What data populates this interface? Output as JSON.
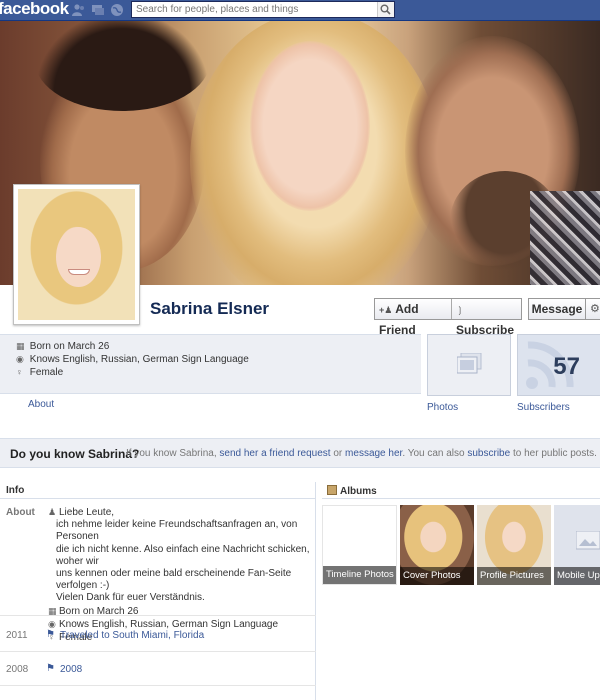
{
  "topbar": {
    "logo": "facebook",
    "search_placeholder": "Search for people, places and things"
  },
  "profile": {
    "name": "Sabrina Elsner"
  },
  "actions": {
    "add_friend": "Add Friend",
    "subscribe": "Subscribe",
    "message": "Message"
  },
  "info_strip": {
    "born": "Born on March 26",
    "languages": "Knows English, Russian, German Sign Language",
    "gender": "Female",
    "about_link": "About"
  },
  "tiles": {
    "photos_label": "Photos",
    "subscribers_label": "Subscribers",
    "subscribers_count": "57"
  },
  "know_bar": {
    "title": "Do you know Sabrina?",
    "t1": "If you know Sabrina,",
    "link1": "send her a friend request",
    "t2": "or",
    "link2": "message her",
    "t3": ". You can also",
    "link3": "subscribe",
    "t4": "to her public posts."
  },
  "info_box": {
    "heading": "Info",
    "about_label": "About",
    "about_lines": [
      "Liebe Leute,",
      "ich nehme leider keine Freundschaftsanfragen an, von Personen",
      "die ich nicht kenne. Also einfach eine Nachricht schicken, woher wir",
      "uns kennen oder meine bald erscheinende Fan-Seite verfolgen :-)",
      "Vielen Dank für euer Verständnis."
    ],
    "born": "Born on March 26",
    "languages": "Knows English, Russian, German Sign Language",
    "gender": "Female",
    "timeline": [
      {
        "year": "2011",
        "event": "Traveled to South Miami, Florida"
      },
      {
        "year": "2008",
        "event": "2008"
      }
    ]
  },
  "albums": {
    "heading": "Albums",
    "items": [
      {
        "label": "Timeline Photos"
      },
      {
        "label": "Cover Photos"
      },
      {
        "label": "Profile Pictures"
      },
      {
        "label": "Mobile Uploads"
      }
    ]
  }
}
